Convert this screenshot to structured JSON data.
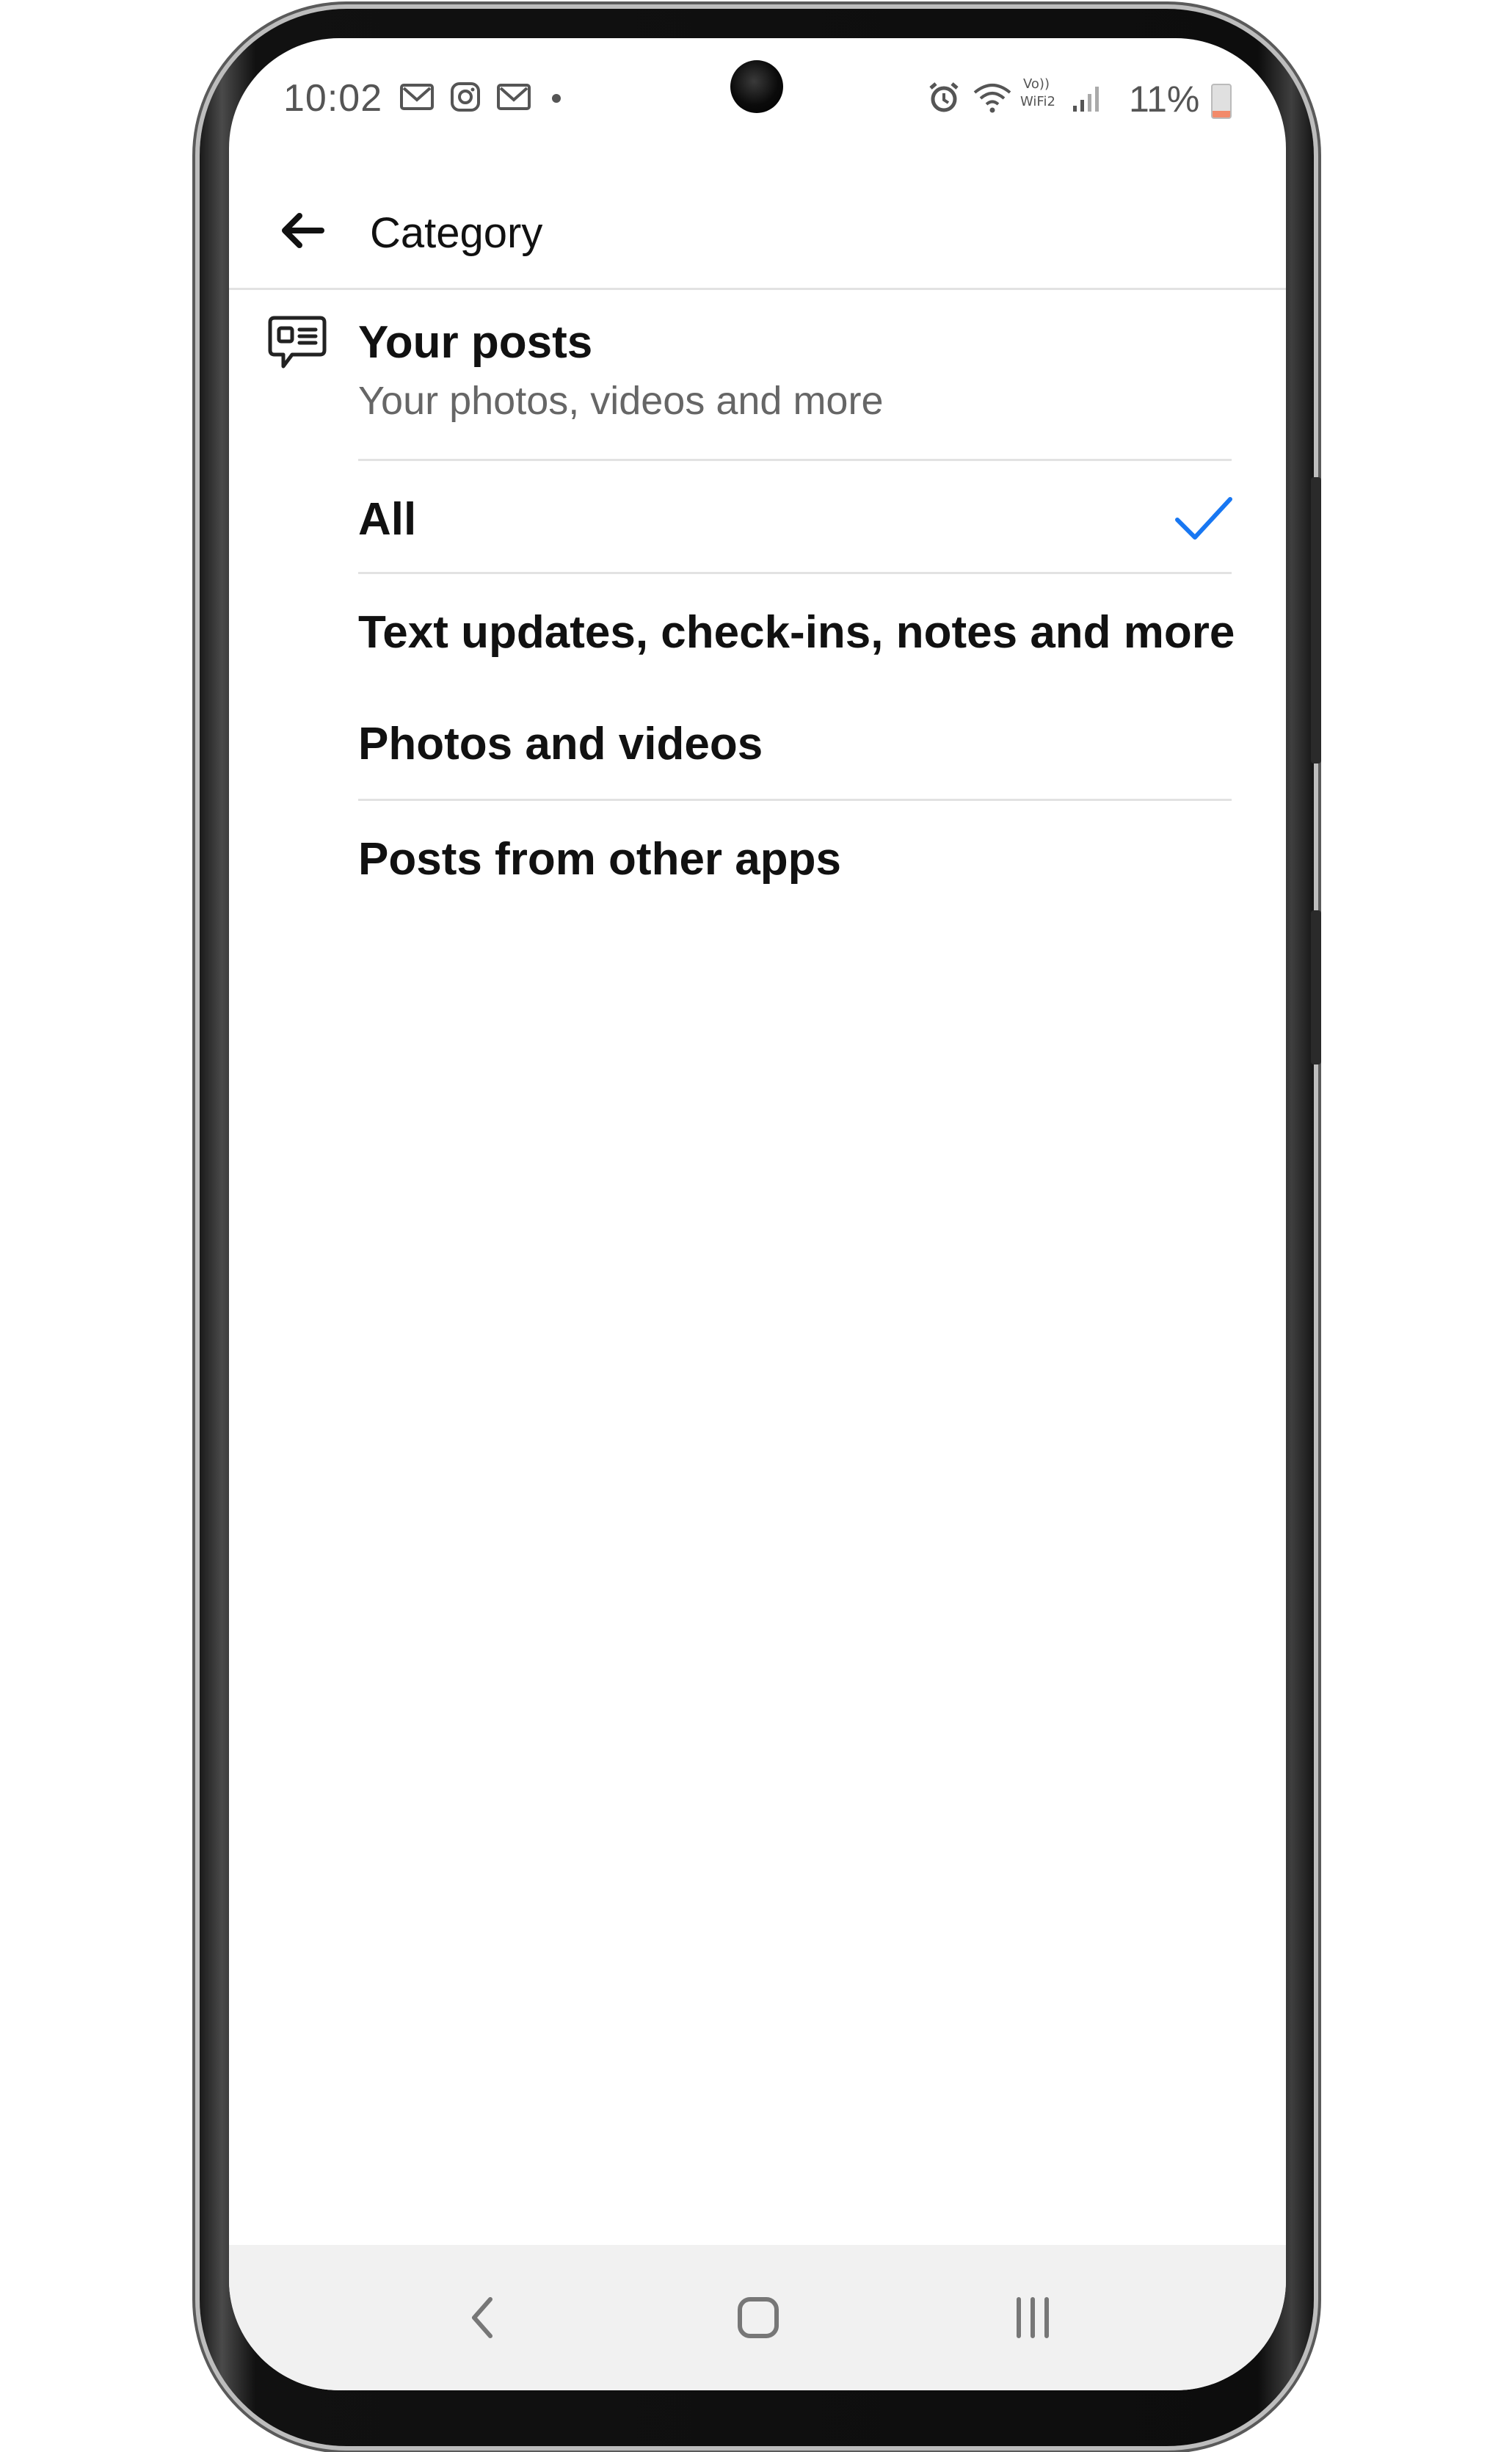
{
  "status_bar": {
    "time": "10:02",
    "battery": "11%",
    "left_icons": [
      "gmail-icon",
      "instagram-icon",
      "gmail-icon",
      "dot-icon"
    ],
    "right_icons": [
      "alarm-icon",
      "wifi-icon",
      "volte-wifi-icon",
      "signal-icon"
    ],
    "battery_color": "#f28a6a"
  },
  "app_bar": {
    "title": "Category",
    "back_icon": "back-arrow-icon"
  },
  "section": {
    "icon": "speech-bubble-list-icon",
    "title": "Your posts",
    "subtitle": "Your photos, videos and more"
  },
  "options": [
    {
      "label": "All",
      "selected": true
    },
    {
      "label": "Text updates, check-ins, notes and more",
      "selected": false
    },
    {
      "label": "Photos and videos",
      "selected": false
    },
    {
      "label": "Posts from other apps",
      "selected": false
    }
  ],
  "colors": {
    "accent": "#1877f2",
    "divider": "#e2e2e2",
    "nav_bg": "#f1f1f1"
  },
  "nav_bar": {
    "buttons": [
      "nav-back-icon",
      "nav-home-icon",
      "nav-recents-icon"
    ]
  }
}
